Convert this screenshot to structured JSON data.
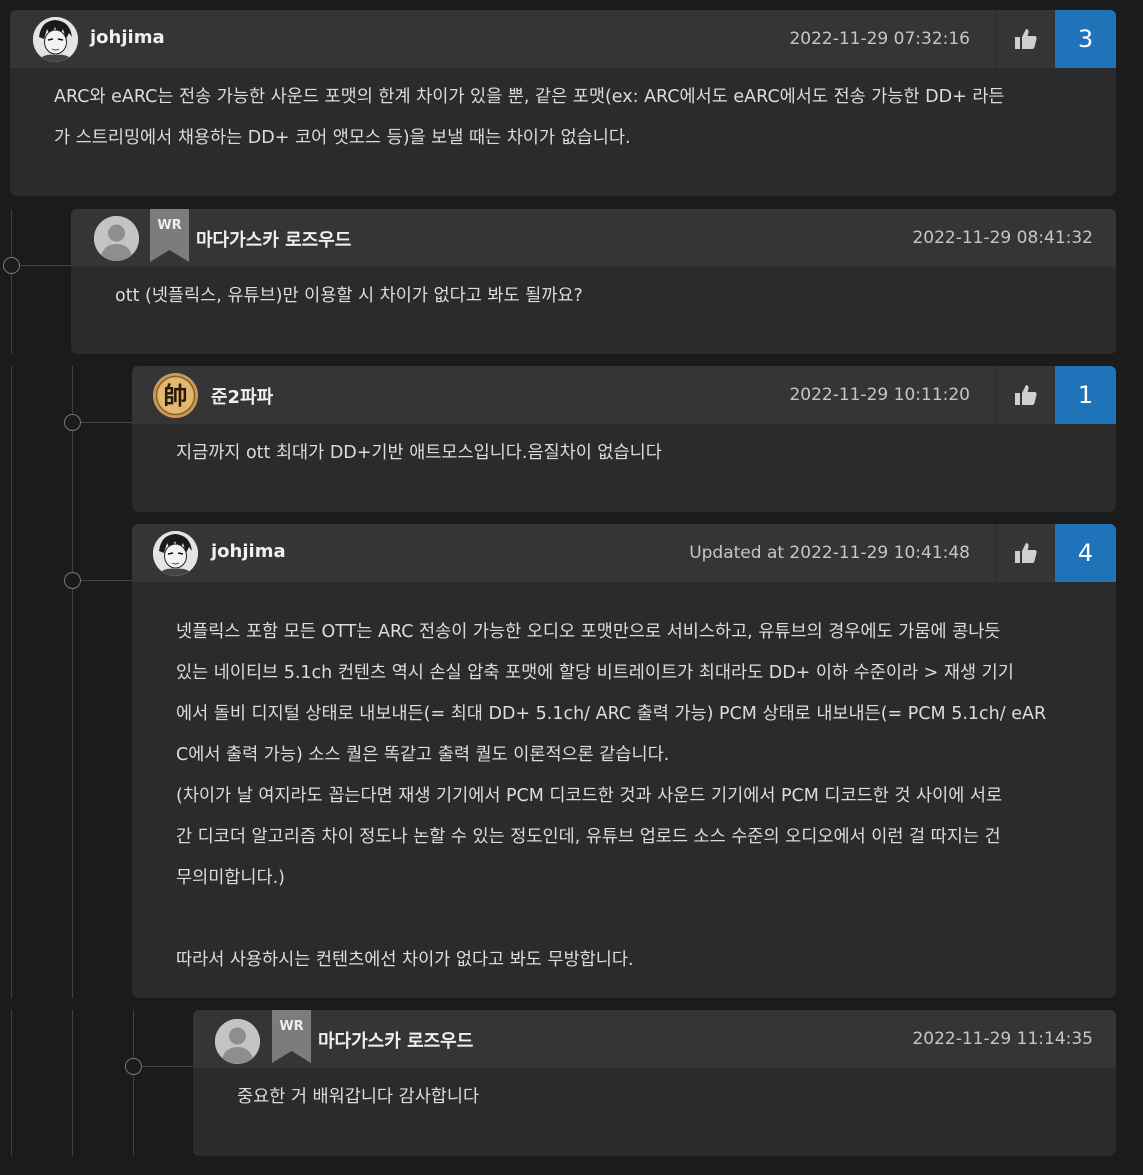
{
  "comments": [
    {
      "author": "johjima",
      "date": "2022-11-29 07:32:16",
      "likes": "3",
      "body": [
        "ARC와 eARC는 전송 가능한 사운드 포맷의 한계 차이가 있을 뿐, 같은 포맷(ex: ARC에서도 eARC에서도 전송 가능한 DD+ 라든",
        "가 스트리밍에서 채용하는 DD+ 코어 앳모스 등)을 보낼 때는 차이가 없습니다."
      ]
    },
    {
      "author": "마다가스카 로즈우드",
      "badge": "WR",
      "date": "2022-11-29 08:41:32",
      "body": [
        "ott (넷플릭스, 유튜브)만 이용할 시 차이가 없다고 봐도 될까요?"
      ]
    },
    {
      "author": "준2파파",
      "avatar_glyph": "帥",
      "date": "2022-11-29 10:11:20",
      "likes": "1",
      "body": [
        "지금까지 ott 최대가 DD+기반 애트모스입니다.음질차이 없습니다"
      ]
    },
    {
      "author": "johjima",
      "date": "Updated at 2022-11-29 10:41:48",
      "likes": "4",
      "body": [
        "넷플릭스 포함 모든 OTT는 ARC 전송이 가능한 오디오 포맷만으로 서비스하고, 유튜브의 경우에도 가뭄에 콩나듯",
        "있는 네이티브 5.1ch 컨텐츠 역시 손실 압축 포맷에 할당 비트레이트가 최대라도 DD+ 이하 수준이라 > 재생 기기",
        "에서 돌비 디지털 상태로 내보내든(= 최대 DD+ 5.1ch/ ARC 출력 가능) PCM 상태로 내보내든(= PCM 5.1ch/ eAR",
        "C에서 출력 가능) 소스 퀄은 똑같고 출력 퀄도 이론적으론 같습니다.",
        "(차이가 날 여지라도 꼽는다면 재생 기기에서 PCM 디코드한 것과 사운드 기기에서 PCM 디코드한 것 사이에 서로",
        "간 디코더 알고리즘 차이 정도나 논할 수 있는 정도인데, 유튜브 업로드 소스 수준의 오디오에서 이런 걸 따지는 건",
        "무의미합니다.)",
        "",
        "따라서 사용하시는 컨텐츠에선 차이가 없다고 봐도 무방합니다."
      ]
    },
    {
      "author": "마다가스카 로즈우드",
      "badge": "WR",
      "date": "2022-11-29 11:14:35",
      "body": [
        "중요한 거 배워갑니다 감사합니다"
      ]
    }
  ],
  "colors": {
    "accent": "#1f73b8",
    "card": "#2b2b2b",
    "header": "#353535"
  }
}
